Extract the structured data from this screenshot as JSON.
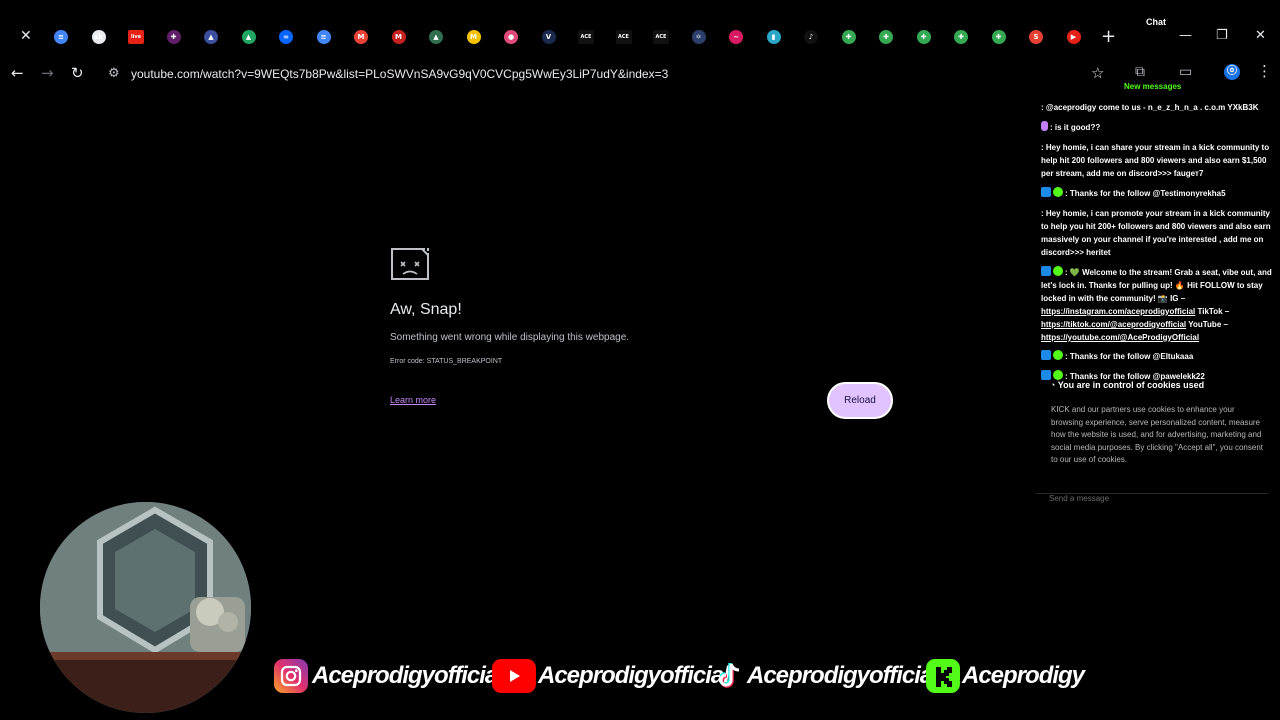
{
  "browser": {
    "tabs": [
      {
        "icon": "docs-icon",
        "color": "#4285f4",
        "glyph": "≡"
      },
      {
        "icon": "sk-icon",
        "color": "#e8eaed",
        "glyph": "sk"
      },
      {
        "icon": "live-icon",
        "color": "#e62117",
        "glyph": "live"
      },
      {
        "icon": "slack-icon",
        "color": "#611f69",
        "glyph": "✚"
      },
      {
        "icon": "triangle-icon",
        "color": "#3c4f9f",
        "glyph": "▲"
      },
      {
        "icon": "drive-icon",
        "color": "#1fa463",
        "glyph": "▲"
      },
      {
        "icon": "meta-icon",
        "color": "#0866ff",
        "glyph": "∞"
      },
      {
        "icon": "docs-icon",
        "color": "#4285f4",
        "glyph": "≡"
      },
      {
        "icon": "gmail-icon",
        "color": "#ea4335",
        "glyph": "M"
      },
      {
        "icon": "gmail-icon",
        "color": "#c5221f",
        "glyph": "M"
      },
      {
        "icon": "triangle-icon",
        "color": "#2f6f4f",
        "glyph": "▲"
      },
      {
        "icon": "coin-icon",
        "color": "#f6c200",
        "glyph": "M"
      },
      {
        "icon": "circle-icon",
        "color": "#e04a7a",
        "glyph": "●"
      },
      {
        "icon": "v-icon",
        "color": "#1a2a4f",
        "glyph": "V"
      },
      {
        "icon": "ace-icon",
        "color": "#111111",
        "glyph": "ACE"
      },
      {
        "icon": "ace-icon",
        "color": "#111111",
        "glyph": "ACE"
      },
      {
        "icon": "ace-icon",
        "color": "#111111",
        "glyph": "ACE"
      },
      {
        "icon": "atom-icon",
        "color": "#2c3e6b",
        "glyph": "⚛"
      },
      {
        "icon": "wave-icon",
        "color": "#d81b60",
        "glyph": "~"
      },
      {
        "icon": "app-icon",
        "color": "#2aa6c7",
        "glyph": "▮"
      },
      {
        "icon": "tiktok-icon",
        "color": "#111111",
        "glyph": "♪"
      },
      {
        "icon": "plus-icon",
        "color": "#34a853",
        "glyph": "✚"
      },
      {
        "icon": "plus-icon",
        "color": "#34a853",
        "glyph": "✚"
      },
      {
        "icon": "plus-icon",
        "color": "#34a853",
        "glyph": "✚"
      },
      {
        "icon": "plus-icon",
        "color": "#34a853",
        "glyph": "✚"
      },
      {
        "icon": "plus-icon",
        "color": "#34a853",
        "glyph": "✚"
      },
      {
        "icon": "s-icon",
        "color": "#e34133",
        "glyph": "S"
      },
      {
        "icon": "youtube-icon",
        "color": "#e62117",
        "glyph": "▶"
      }
    ],
    "url": "youtube.com/watch?v=9WEQts7b8Pw&list=PLoSWVnSA9vG9qV0CVCpg5WwEy3LiP7udY&index=3"
  },
  "error": {
    "title": "Aw, Snap!",
    "message": "Something went wrong while displaying this webpage.",
    "code": "Error code: STATUS_BREAKPOINT",
    "learn_more": "Learn more",
    "reload": "Reload"
  },
  "chat": {
    "title": "Chat",
    "new_messages": "New messages",
    "messages": [
      {
        "badges": [],
        "text": ": @aceprodigy come to us - n_e_z_h_n_a . c.o.m YXkB3K"
      },
      {
        "badges": [
          "mic"
        ],
        "text": ": is it good??"
      },
      {
        "badges": [],
        "text": ": Hey homie, i can share your stream in a kick community to help hit 200 followers and 800 viewers and also earn $1,500 per stream, add me on discord>>> faugeт7"
      },
      {
        "badges": [
          "bot",
          "verified"
        ],
        "text": ": Thanks for the follow @Testimonyrekha5"
      },
      {
        "badges": [],
        "text": ": Hey homie, i can promote your stream in a kick community to help you hit 200+ followers and 800 viewers and also earn massively on your channel if you're interested , add me on discord>>> heritet"
      },
      {
        "badges": [
          "bot",
          "verified"
        ],
        "text": ": 💚 Welcome to the stream! Grab a seat, vibe out, and let's lock in. Thanks for pulling up! 🔥 Hit FOLLOW to stay locked in with the community! 📸 IG –"
      },
      {
        "badges": [
          "bot",
          "verified"
        ],
        "text": ": Thanks for the follow @Eltukaaa"
      },
      {
        "badges": [
          "bot",
          "verified"
        ],
        "text": ": Thanks for the follow @pawelekk22"
      }
    ],
    "links": {
      "ig": "https://instagram.com/aceprodigyofficial",
      "tiktok_label": "TikTok –",
      "tiktok": "https://tiktok.com/@aceprodigyofficial",
      "youtube_label": "YouTube –",
      "youtube": "https://youtube.com/@AceProdigyOfficial"
    },
    "cookie_title": "You are in control of cookies used",
    "cookie_text": "KICK and our partners use cookies to enhance your browsing experience, serve personalized content, measure how the website is used, and for advertising, marketing and social media purposes. By clicking \"Accept all\", you consent to our use of cookies.",
    "send_placeholder": "Send a message"
  },
  "socials": [
    {
      "platform": "instagram",
      "handle": "Aceprodigyofficial",
      "color": "#e1306c"
    },
    {
      "platform": "youtube",
      "handle": "Aceprodigyofficial",
      "color": "#ff0000"
    },
    {
      "platform": "tiktok",
      "handle": "Aceprodigyofficial",
      "color": "#111111"
    },
    {
      "platform": "kick",
      "handle": "Aceprodigy",
      "color": "#53fc18"
    }
  ],
  "colors": {
    "accent_kick": "#53fc18",
    "reload_bg": "#e0c3ff",
    "learn_more": "#c58af9"
  }
}
